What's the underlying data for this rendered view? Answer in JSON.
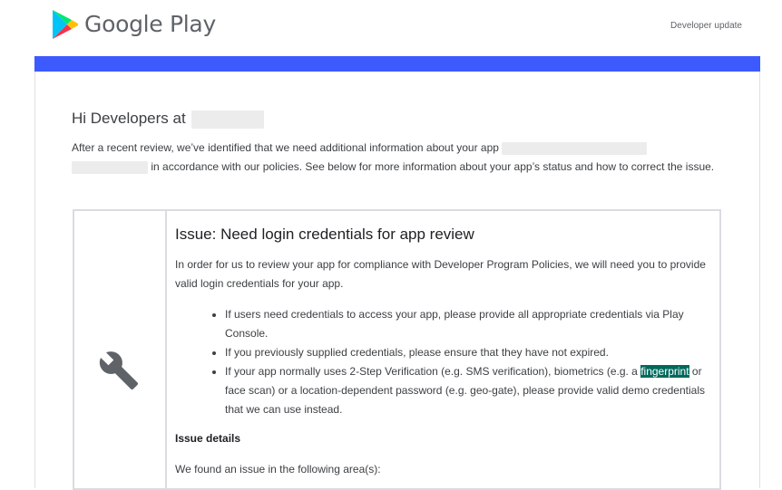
{
  "header": {
    "brand": "Google Play",
    "right_label": "Developer update"
  },
  "colors": {
    "accent_bar": "#3d5afe",
    "highlight": "#00695c"
  },
  "greeting": "Hi Developers at",
  "intro": {
    "part1": "After a recent review, we’ve identified that we need additional information about your app",
    "part2": "in accordance with our policies. See below for more information about your app’s status and how to correct the issue."
  },
  "issue": {
    "icon": "wrench-icon",
    "title": "Issue: Need login credentials for app review",
    "description": "In order for us to review your app for compliance with Developer Program Policies, we will need you to provide valid login credentials for your app.",
    "bullets": [
      "If users need credentials to access your app, please provide all appropriate credentials via Play Console.",
      "If you previously supplied credentials, please ensure that they have not expired."
    ],
    "bullet3_before": "If your app normally uses 2-Step Verification (e.g. SMS verification), biometrics (e.g. a ",
    "bullet3_highlight": "fingerprint",
    "bullet3_after": " or face scan) or a location-dependent password (e.g. geo-gate), please provide valid demo credentials that we can use instead.",
    "details_heading": "Issue details",
    "found_text": "We found an issue in the following area(s):"
  }
}
